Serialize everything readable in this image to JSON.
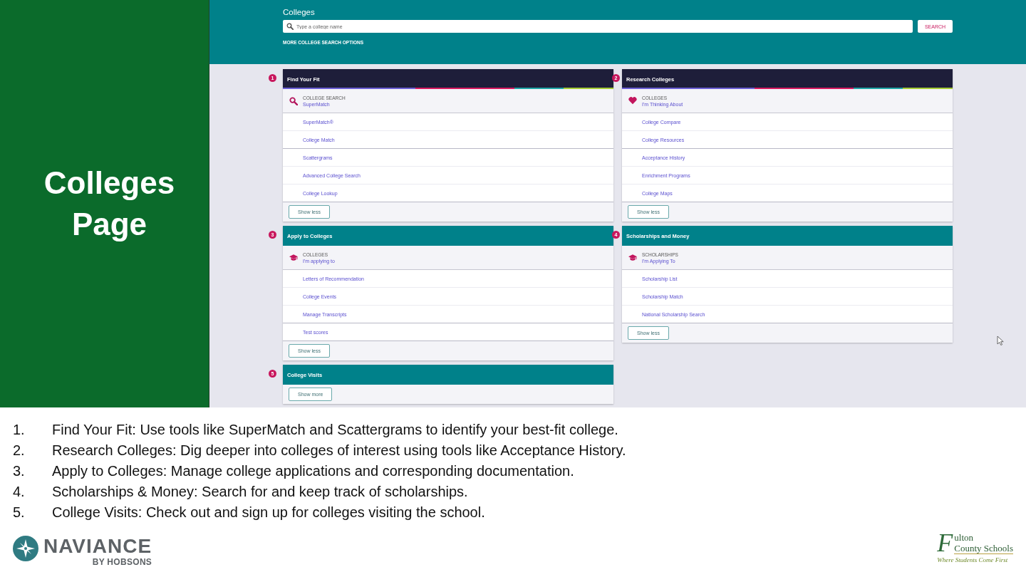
{
  "slide": {
    "title": "Colleges Page",
    "app": {
      "header": {
        "title": "Colleges",
        "search_field": {
          "placeholder": "Type a college name"
        },
        "search_button": "SEARCH",
        "more_options_link": "MORE COLLEGE SEARCH OPTIONS"
      },
      "cards": [
        {
          "number": "1",
          "title": "Find Your Fit",
          "color": "#1e1e3a",
          "stripe": true,
          "featured": {
            "label": "COLLEGE SEARCH",
            "link": "SuperMatch"
          },
          "link_groups": [
            [
              "SuperMatch®",
              "College Match"
            ],
            [
              "Scattergrams",
              "Advanced College Search",
              "College Lookup"
            ]
          ],
          "toggle_button": "Show less"
        },
        {
          "number": "2",
          "title": "Research Colleges",
          "color": "#1e1e3a",
          "stripe": true,
          "featured": {
            "label": "COLLEGES",
            "link": "I'm Thinking About"
          },
          "link_groups": [
            [
              "College Compare",
              "College Resources"
            ],
            [
              "Acceptance History",
              "Enrichment Programs",
              "College Maps"
            ]
          ],
          "toggle_button": "Show less"
        },
        {
          "number": "3",
          "title": "Apply to Colleges",
          "color": "#00818a",
          "stripe": false,
          "featured": {
            "label": "COLLEGES",
            "link": "I'm applying to"
          },
          "link_groups": [
            [
              "Letters of Recommendation",
              "College Events",
              "Manage Transcripts"
            ],
            [
              "Test scores"
            ]
          ],
          "toggle_button": "Show less"
        },
        {
          "number": "4",
          "title": "Scholarships and Money",
          "color": "#00818a",
          "stripe": false,
          "featured": {
            "label": "SCHOLARSHIPS",
            "link": "I'm Applying To"
          },
          "link_groups": [
            [
              "Scholarship List",
              "Scholarship Match",
              "National Scholarship Search"
            ]
          ],
          "toggle_button": "Show less"
        },
        {
          "number": "5",
          "title": "College Visits",
          "color": "#00818a",
          "stripe": false,
          "toggle_button": "Show more"
        }
      ]
    },
    "notes": [
      {
        "number": "1.",
        "text": "Find Your Fit: Use tools like SuperMatch and Scattergrams to identify your best-fit college."
      },
      {
        "number": "2.",
        "text": "Research Colleges: Dig deeper into colleges of interest using tools like Acceptance History."
      },
      {
        "number": "3.",
        "text": "Apply to Colleges: Manage college applications and corresponding documentation."
      },
      {
        "number": "4.",
        "text": "Scholarships & Money: Search for and keep track of scholarships."
      },
      {
        "number": "5.",
        "text": "College Visits: Check out and sign up for colleges visiting the school."
      }
    ],
    "logos": {
      "naviance": {
        "name": "NAVIANCE",
        "byline": "BY HOBSONS"
      },
      "district": {
        "initial": "F",
        "name_rest": "ulton",
        "line2": "County Schools",
        "tagline": "Where Students Come First"
      }
    }
  }
}
